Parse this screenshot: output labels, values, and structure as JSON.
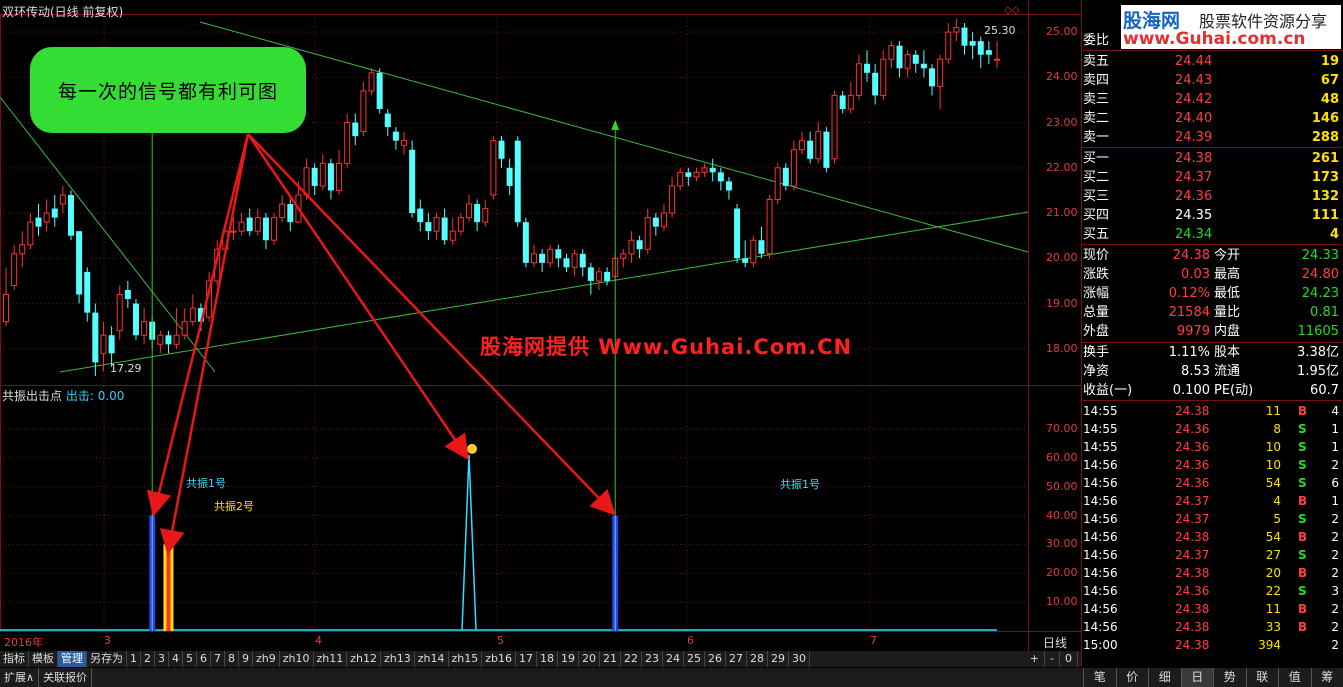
{
  "window": {
    "title": "双环传动(日线 前复权)"
  },
  "callout": {
    "text": "每一次的信号都有利可图"
  },
  "watermark": {
    "text": "股海网提供 Www.Guhai.Com.CN"
  },
  "price_axis": {
    "labels": [
      "25.00",
      "24.00",
      "23.00",
      "22.00",
      "21.00",
      "20.00",
      "19.00",
      "18.00"
    ]
  },
  "indicator_axis": {
    "labels": [
      "70.00",
      "60.00",
      "50.00",
      "40.00",
      "30.00",
      "20.00",
      "10.00"
    ]
  },
  "annotations": {
    "high_label": "25.30",
    "low_label": "17.29",
    "signal1_left": "共振1号",
    "signal2": "共振2号",
    "signal1_right": "共振1号"
  },
  "indicator": {
    "name": "共振出击点",
    "output_label": "出击:",
    "output_value": "0.00"
  },
  "date_axis": {
    "labels": [
      "2016年",
      "3",
      "4",
      "5",
      "6",
      "7"
    ],
    "period": "日线"
  },
  "tabs": {
    "items": [
      "指标",
      "模板",
      "管理",
      "另存为",
      "1",
      "2",
      "3",
      "4",
      "5",
      "6",
      "7",
      "8",
      "9",
      "zh9",
      "zh10",
      "zh11",
      "zh12",
      "zh13",
      "zh14",
      "zh15",
      "zb16",
      "17",
      "18",
      "19",
      "20",
      "21",
      "22",
      "23",
      "24",
      "25",
      "26",
      "27",
      "28",
      "29",
      "30"
    ],
    "active": "管理",
    "controls": [
      "+",
      "-",
      "0"
    ]
  },
  "status": {
    "items": [
      "扩展∧",
      "关联报价"
    ]
  },
  "logo": {
    "line1": "股海网",
    "line2": "股票软件资源分享",
    "line3": "www.Guhai.com.cn"
  },
  "quote": {
    "wei_bi_label": "委比",
    "sell": [
      {
        "label": "卖五",
        "price": "24.44",
        "vol": "19"
      },
      {
        "label": "卖四",
        "price": "24.43",
        "vol": "67"
      },
      {
        "label": "卖三",
        "price": "24.42",
        "vol": "48"
      },
      {
        "label": "卖二",
        "price": "24.40",
        "vol": "146"
      },
      {
        "label": "卖一",
        "price": "24.39",
        "vol": "288"
      }
    ],
    "buy": [
      {
        "label": "买一",
        "price": "24.38",
        "vol": "261"
      },
      {
        "label": "买二",
        "price": "24.37",
        "vol": "173"
      },
      {
        "label": "买三",
        "price": "24.36",
        "vol": "132"
      },
      {
        "label": "买四",
        "price": "24.35",
        "vol": "111"
      },
      {
        "label": "买五",
        "price": "24.34",
        "vol": "4"
      }
    ],
    "stats": [
      {
        "l1": "现价",
        "v1": "24.38",
        "l2": "今开",
        "v2": "24.33"
      },
      {
        "l1": "涨跌",
        "v1": "0.03",
        "l2": "最高",
        "v2": "24.80"
      },
      {
        "l1": "涨幅",
        "v1": "0.12%",
        "l2": "最低",
        "v2": "24.23"
      },
      {
        "l1": "总量",
        "v1": "21584",
        "l2": "量比",
        "v2": "0.81"
      },
      {
        "l1": "外盘",
        "v1": "9979",
        "l2": "内盘",
        "v2": "11605"
      }
    ],
    "stats2": [
      {
        "l1": "换手",
        "v1": "1.11%",
        "l2": "股本",
        "v2": "3.38亿"
      },
      {
        "l1": "净资",
        "v1": "8.53",
        "l2": "流通",
        "v2": "1.95亿"
      },
      {
        "l1": "收益(一)",
        "v1": "0.100",
        "l2": "PE(动)",
        "v2": "60.7"
      }
    ]
  },
  "ticks": [
    {
      "time": "14:55",
      "price": "24.38",
      "vol": "11",
      "side": "B",
      "n": "4"
    },
    {
      "time": "14:55",
      "price": "24.36",
      "vol": "8",
      "side": "S",
      "n": "1"
    },
    {
      "time": "14:55",
      "price": "24.36",
      "vol": "10",
      "side": "S",
      "n": "1"
    },
    {
      "time": "14:56",
      "price": "24.36",
      "vol": "10",
      "side": "S",
      "n": "2"
    },
    {
      "time": "14:56",
      "price": "24.36",
      "vol": "54",
      "side": "S",
      "n": "6"
    },
    {
      "time": "14:56",
      "price": "24.37",
      "vol": "4",
      "side": "B",
      "n": "1"
    },
    {
      "time": "14:56",
      "price": "24.37",
      "vol": "5",
      "side": "S",
      "n": "2"
    },
    {
      "time": "14:56",
      "price": "24.38",
      "vol": "54",
      "side": "B",
      "n": "2"
    },
    {
      "time": "14:56",
      "price": "24.37",
      "vol": "27",
      "side": "S",
      "n": "2"
    },
    {
      "time": "14:56",
      "price": "24.38",
      "vol": "20",
      "side": "B",
      "n": "2"
    },
    {
      "time": "14:56",
      "price": "24.36",
      "vol": "22",
      "side": "S",
      "n": "3"
    },
    {
      "time": "14:56",
      "price": "24.38",
      "vol": "11",
      "side": "B",
      "n": "2"
    },
    {
      "time": "14:56",
      "price": "24.38",
      "vol": "33",
      "side": "B",
      "n": "2"
    },
    {
      "time": "15:00",
      "price": "24.38",
      "vol": "394",
      "side": "",
      "n": "2"
    }
  ],
  "bottom_tabs": [
    "笔",
    "价",
    "细",
    "日",
    "势",
    "联",
    "值",
    "筹"
  ],
  "bottom_tab_active": "日",
  "colors": {
    "up": "#ff3030",
    "down": "#54ffff",
    "trend": "#3dbb3d",
    "arrow": "#e81818",
    "grid": "#7a1010"
  },
  "chart_data": {
    "type": "candlestick",
    "price_range": [
      17.2,
      25.4
    ],
    "candles": [
      [
        19.2,
        18.6,
        19.8,
        18.5,
        "u"
      ],
      [
        20.1,
        19.4,
        20.3,
        19.3,
        "u"
      ],
      [
        20.3,
        20.1,
        20.6,
        19.8,
        "u"
      ],
      [
        20.8,
        20.3,
        21.0,
        20.2,
        "u"
      ],
      [
        20.9,
        20.7,
        21.2,
        20.5,
        "d"
      ],
      [
        21.0,
        20.8,
        21.3,
        20.6,
        "u"
      ],
      [
        21.1,
        20.9,
        21.4,
        20.7,
        "d"
      ],
      [
        21.4,
        21.2,
        21.6,
        21.0,
        "u"
      ],
      [
        21.4,
        20.5,
        21.5,
        20.4,
        "d"
      ],
      [
        20.6,
        19.2,
        20.6,
        19.0,
        "d"
      ],
      [
        19.7,
        18.8,
        19.8,
        18.6,
        "d"
      ],
      [
        18.8,
        17.7,
        19.0,
        17.4,
        "d"
      ],
      [
        17.9,
        18.3,
        18.6,
        17.5,
        "u"
      ],
      [
        18.3,
        17.9,
        18.5,
        17.6,
        "d"
      ],
      [
        18.4,
        19.2,
        19.4,
        18.2,
        "u"
      ],
      [
        19.3,
        19.1,
        19.5,
        18.9,
        "d"
      ],
      [
        19.0,
        18.3,
        19.1,
        18.2,
        "d"
      ],
      [
        18.3,
        18.6,
        18.9,
        18.1,
        "u"
      ],
      [
        18.6,
        18.2,
        18.7,
        18.0,
        "d"
      ],
      [
        18.1,
        18.3,
        18.4,
        17.9,
        "u"
      ],
      [
        18.3,
        18.1,
        18.4,
        17.9,
        "d"
      ],
      [
        18.1,
        18.3,
        18.9,
        18.0,
        "u"
      ],
      [
        18.3,
        18.6,
        18.9,
        18.2,
        "u"
      ],
      [
        18.6,
        18.9,
        19.2,
        18.5,
        "u"
      ],
      [
        18.9,
        18.6,
        19.0,
        18.4,
        "d"
      ],
      [
        18.7,
        19.5,
        19.7,
        18.6,
        "u"
      ],
      [
        19.5,
        20.2,
        20.4,
        19.4,
        "u"
      ],
      [
        20.2,
        20.6,
        20.8,
        20.1,
        "u"
      ],
      [
        20.6,
        20.6,
        20.9,
        20.4,
        "u"
      ],
      [
        20.6,
        20.8,
        21.0,
        20.5,
        "u"
      ],
      [
        20.9,
        20.6,
        21.1,
        20.5,
        "d"
      ],
      [
        20.6,
        20.9,
        21.1,
        20.5,
        "u"
      ],
      [
        20.9,
        20.4,
        21.0,
        20.2,
        "d"
      ],
      [
        20.4,
        20.9,
        21.0,
        20.3,
        "u"
      ],
      [
        20.9,
        21.2,
        21.4,
        20.8,
        "u"
      ],
      [
        21.2,
        20.8,
        21.3,
        20.6,
        "d"
      ],
      [
        20.8,
        21.4,
        21.7,
        20.8,
        "u"
      ],
      [
        21.4,
        22.0,
        22.2,
        21.3,
        "u"
      ],
      [
        22.0,
        21.6,
        22.1,
        21.4,
        "d"
      ],
      [
        21.6,
        22.1,
        22.3,
        21.5,
        "u"
      ],
      [
        22.1,
        21.5,
        22.2,
        21.3,
        "d"
      ],
      [
        21.5,
        22.1,
        22.4,
        21.4,
        "u"
      ],
      [
        22.1,
        23.0,
        23.2,
        22.0,
        "u"
      ],
      [
        23.0,
        22.7,
        23.2,
        22.5,
        "d"
      ],
      [
        22.8,
        23.7,
        23.9,
        22.7,
        "u"
      ],
      [
        23.7,
        24.1,
        24.2,
        23.6,
        "u"
      ],
      [
        24.1,
        23.3,
        24.2,
        23.2,
        "d"
      ],
      [
        23.2,
        22.9,
        23.3,
        22.7,
        "d"
      ],
      [
        22.8,
        22.6,
        22.9,
        22.4,
        "d"
      ],
      [
        22.6,
        22.5,
        22.8,
        22.3,
        "u"
      ],
      [
        22.4,
        21.0,
        22.6,
        20.9,
        "d"
      ],
      [
        21.1,
        20.8,
        21.3,
        20.6,
        "d"
      ],
      [
        20.8,
        20.6,
        21.0,
        20.4,
        "d"
      ],
      [
        20.6,
        20.9,
        21.0,
        20.4,
        "u"
      ],
      [
        20.9,
        20.4,
        21.1,
        20.3,
        "d"
      ],
      [
        20.4,
        20.6,
        20.9,
        20.3,
        "u"
      ],
      [
        20.6,
        20.9,
        21.0,
        20.5,
        "u"
      ],
      [
        20.9,
        21.2,
        21.4,
        20.8,
        "u"
      ],
      [
        21.2,
        20.8,
        21.3,
        20.6,
        "d"
      ],
      [
        20.8,
        21.1,
        21.3,
        20.7,
        "u"
      ],
      [
        21.4,
        22.6,
        22.7,
        21.3,
        "u"
      ],
      [
        22.6,
        22.2,
        22.7,
        22.0,
        "d"
      ],
      [
        22.0,
        21.6,
        22.2,
        21.4,
        "d"
      ],
      [
        22.6,
        20.8,
        22.7,
        20.7,
        "d"
      ],
      [
        20.8,
        19.9,
        20.9,
        19.8,
        "d"
      ],
      [
        19.9,
        20.1,
        20.3,
        19.8,
        "u"
      ],
      [
        20.1,
        19.9,
        20.2,
        19.7,
        "d"
      ],
      [
        19.9,
        20.2,
        20.3,
        19.8,
        "u"
      ],
      [
        20.2,
        20.0,
        20.3,
        19.8,
        "d"
      ],
      [
        20.0,
        19.8,
        20.1,
        19.7,
        "d"
      ],
      [
        19.8,
        20.1,
        20.2,
        19.6,
        "u"
      ],
      [
        20.1,
        19.8,
        20.2,
        19.6,
        "d"
      ],
      [
        19.8,
        19.5,
        19.9,
        19.2,
        "d"
      ],
      [
        19.5,
        19.7,
        19.8,
        19.3,
        "u"
      ],
      [
        19.7,
        19.5,
        19.8,
        19.4,
        "d"
      ],
      [
        19.6,
        20.0,
        20.1,
        19.5,
        "u"
      ],
      [
        20.0,
        20.1,
        20.2,
        19.8,
        "u"
      ],
      [
        20.1,
        20.4,
        20.6,
        19.9,
        "u"
      ],
      [
        20.4,
        20.2,
        20.5,
        20.0,
        "d"
      ],
      [
        20.2,
        20.9,
        21.1,
        20.1,
        "u"
      ],
      [
        20.9,
        20.7,
        21.0,
        20.5,
        "d"
      ],
      [
        20.7,
        21.0,
        21.2,
        20.6,
        "u"
      ],
      [
        21.0,
        21.6,
        21.8,
        20.9,
        "u"
      ],
      [
        21.6,
        21.9,
        22.0,
        21.5,
        "u"
      ],
      [
        21.9,
        21.8,
        22.0,
        21.6,
        "d"
      ],
      [
        21.8,
        21.9,
        22.0,
        21.7,
        "u"
      ],
      [
        21.9,
        22.0,
        22.1,
        21.8,
        "u"
      ],
      [
        22.0,
        21.9,
        22.2,
        21.7,
        "d"
      ],
      [
        21.9,
        21.7,
        22.0,
        21.5,
        "d"
      ],
      [
        21.7,
        21.5,
        21.8,
        21.3,
        "d"
      ],
      [
        21.1,
        20.0,
        21.2,
        19.9,
        "d"
      ],
      [
        20.0,
        19.9,
        20.4,
        19.8,
        "d"
      ],
      [
        19.9,
        20.4,
        20.5,
        19.8,
        "u"
      ],
      [
        20.4,
        20.1,
        20.7,
        20.0,
        "d"
      ],
      [
        20.1,
        21.3,
        21.4,
        20.0,
        "u"
      ],
      [
        21.3,
        22.0,
        22.1,
        21.2,
        "u"
      ],
      [
        22.0,
        21.6,
        22.1,
        21.5,
        "d"
      ],
      [
        21.6,
        22.4,
        22.6,
        21.5,
        "u"
      ],
      [
        22.4,
        22.6,
        22.8,
        22.3,
        "u"
      ],
      [
        22.6,
        22.2,
        22.8,
        22.1,
        "d"
      ],
      [
        22.2,
        22.8,
        23.0,
        22.1,
        "u"
      ],
      [
        22.8,
        22.0,
        22.9,
        21.9,
        "d"
      ],
      [
        22.2,
        23.6,
        23.7,
        22.1,
        "u"
      ],
      [
        23.6,
        23.3,
        23.7,
        23.2,
        "d"
      ],
      [
        23.3,
        23.6,
        23.9,
        23.2,
        "u"
      ],
      [
        23.6,
        24.3,
        24.5,
        23.5,
        "u"
      ],
      [
        24.3,
        24.1,
        24.6,
        23.9,
        "d"
      ],
      [
        24.1,
        23.6,
        24.3,
        23.4,
        "d"
      ],
      [
        23.6,
        24.4,
        24.6,
        23.5,
        "u"
      ],
      [
        24.4,
        24.7,
        24.8,
        24.2,
        "u"
      ],
      [
        24.7,
        24.2,
        24.8,
        24.0,
        "d"
      ],
      [
        24.2,
        24.5,
        24.6,
        24.0,
        "u"
      ],
      [
        24.5,
        24.3,
        24.6,
        24.1,
        "d"
      ],
      [
        24.3,
        24.2,
        24.6,
        24.0,
        "d"
      ],
      [
        24.2,
        23.8,
        24.3,
        23.6,
        "d"
      ],
      [
        23.8,
        24.4,
        24.5,
        23.3,
        "u"
      ],
      [
        24.4,
        25.0,
        25.2,
        24.3,
        "u"
      ],
      [
        25.0,
        25.1,
        25.3,
        24.8,
        "u"
      ],
      [
        25.1,
        24.7,
        25.2,
        24.5,
        "d"
      ],
      [
        24.7,
        24.8,
        25.0,
        24.4,
        "d"
      ],
      [
        24.8,
        24.5,
        24.9,
        24.2,
        "d"
      ],
      [
        24.5,
        24.6,
        24.8,
        24.3,
        "d"
      ],
      [
        24.4,
        24.4,
        24.8,
        24.2,
        "u"
      ]
    ],
    "indicator_series": {
      "signals": [
        {
          "index": 18,
          "value": 40,
          "type": "共振1号"
        },
        {
          "index": 20,
          "value": 30,
          "type": "共振2号"
        },
        {
          "index": 57,
          "value": 61,
          "type": "peak"
        },
        {
          "index": 75,
          "value": 40,
          "type": "共振1号"
        }
      ],
      "ylim": [
        0,
        80
      ]
    }
  }
}
